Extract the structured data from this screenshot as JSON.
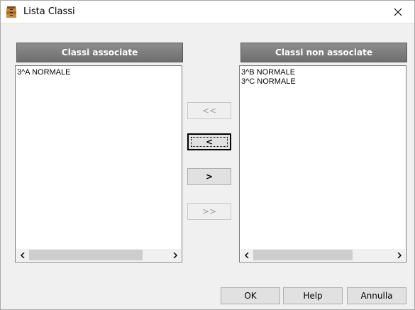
{
  "window": {
    "title": "Lista Classi"
  },
  "left_panel": {
    "header": "Classi associate",
    "items": [
      "3^A NORMALE"
    ]
  },
  "right_panel": {
    "header": "Classi non associate",
    "items": [
      "3^B NORMALE",
      "3^C NORMALE"
    ]
  },
  "move_buttons": {
    "add_all": "<<",
    "add_one": "<",
    "remove_one": ">",
    "remove_all": ">>"
  },
  "footer": {
    "ok": "OK",
    "help": "Help",
    "cancel": "Annulla"
  },
  "icons": {
    "app": "archive-cabinet-icon",
    "close": "close-icon",
    "scroll_left": "chevron-left-icon",
    "scroll_right": "chevron-right-icon"
  }
}
